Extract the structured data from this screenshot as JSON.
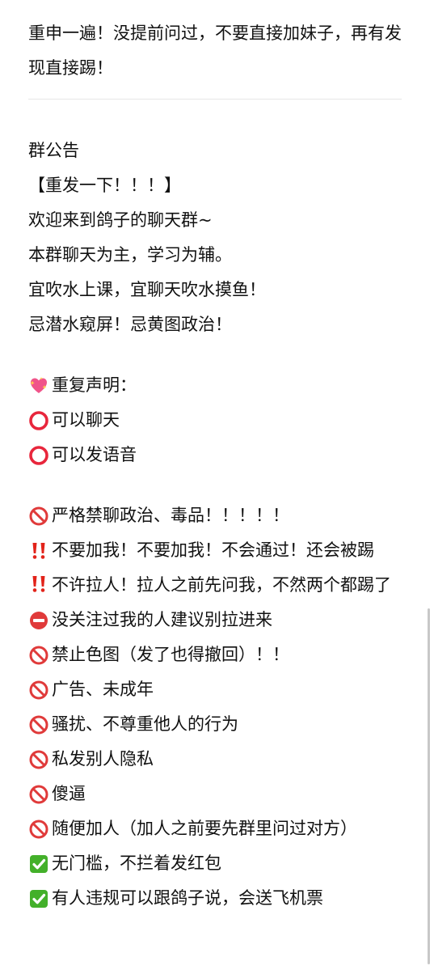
{
  "intro": "重申一遍！没提前问过，不要直接加妹子，再有发现直接踢！",
  "announcement": {
    "title": "群公告",
    "repost": "【重发一下！！！】",
    "lines": [
      "欢迎来到鸽子的聊天群~",
      "本群聊天为主，学习为辅。",
      "宜吹水上课，宜聊天吹水摸鱼！",
      "忌潜水窥屏！忌黄图政治！"
    ]
  },
  "statement": {
    "header_icon": "sparkling-heart-icon",
    "header": "重复声明：",
    "allowed": [
      {
        "icon": "circle-icon",
        "text": "可以聊天"
      },
      {
        "icon": "circle-icon",
        "text": "可以发语音"
      }
    ]
  },
  "rules": [
    {
      "icon": "prohibited-icon",
      "text": "严格禁聊政治、毒品！！！！！"
    },
    {
      "icon": "double-exclamation-icon",
      "text": "不要加我！不要加我！不会通过！还会被踢"
    },
    {
      "icon": "double-exclamation-icon",
      "text": "不许拉人！拉人之前先问我，不然两个都踢了"
    },
    {
      "icon": "no-entry-icon",
      "text": "没关注过我的人建议别拉进来"
    },
    {
      "icon": "prohibited-icon",
      "text": "禁止色图（发了也得撤回）！！"
    },
    {
      "icon": "prohibited-icon",
      "text": "广告、未成年"
    },
    {
      "icon": "prohibited-icon",
      "text": "骚扰、不尊重他人的行为"
    },
    {
      "icon": "prohibited-icon",
      "text": "私发别人隐私"
    },
    {
      "icon": "prohibited-icon",
      "text": "傻逼"
    },
    {
      "icon": "prohibited-icon",
      "text": "随便加人（加人之前要先群里问过对方）"
    },
    {
      "icon": "check-mark-button-icon",
      "text": "无门槛，不拦着发红包"
    },
    {
      "icon": "check-mark-button-icon",
      "text": "有人违规可以跟鸽子说，会送飞机票"
    }
  ],
  "colors": {
    "text": "#111111",
    "prohibited_red": "#e03a3a",
    "circle_red": "#e8263c",
    "exclamation_red": "#e2231a",
    "check_green": "#43b02a",
    "heart_pink": "#f0548a",
    "divider": "#e6e6e6"
  }
}
